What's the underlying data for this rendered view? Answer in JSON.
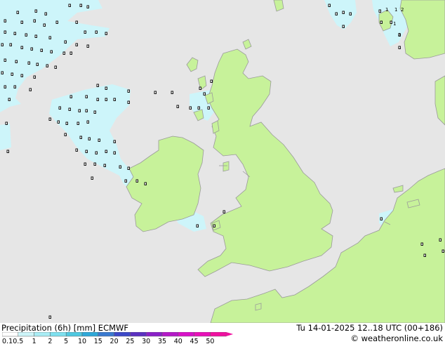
{
  "footer": {
    "title": "Precipitation (6h) [mm] ECMWF",
    "datetime": "Tu 14-01-2025 12..18 UTC (00+186)",
    "credit": "© weatheronline.co.uk"
  },
  "legend": {
    "labels": [
      "0.1",
      "0.5",
      "1",
      "2",
      "5",
      "10",
      "15",
      "20",
      "25",
      "30",
      "35",
      "40",
      "45",
      "50"
    ],
    "colors": [
      "#ffffff",
      "#ccf4f8",
      "#a8ecf4",
      "#7ee0ee",
      "#4ec8e0",
      "#2ea8d8",
      "#3a7ad0",
      "#3c48c8",
      "#5a30c0",
      "#8a20c8",
      "#b418c8",
      "#d810c8",
      "#e810b8",
      "#f010a0"
    ]
  },
  "map": {
    "colors": {
      "sea": "#e6e6e6",
      "land": "#c7f29a",
      "coast": "#9a9a9a",
      "precip": "#cdf5fa"
    },
    "numbers": [
      "1",
      "1",
      "2",
      "1",
      "2"
    ]
  }
}
